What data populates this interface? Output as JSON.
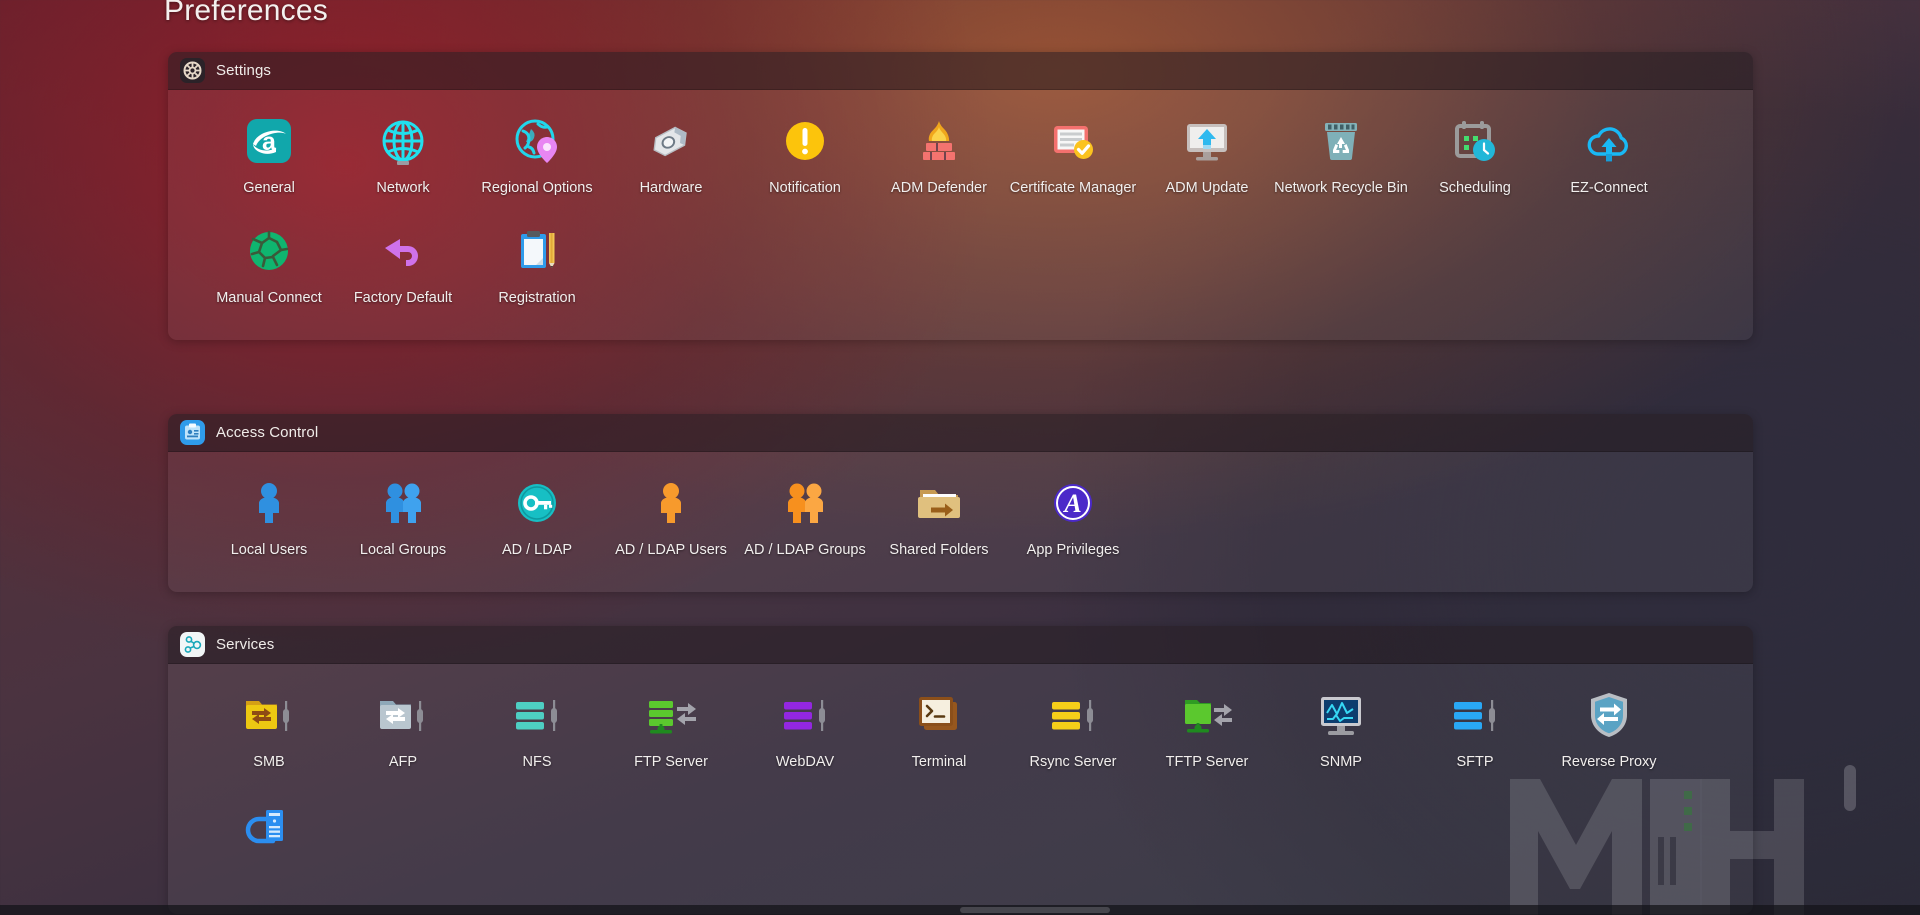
{
  "page": {
    "title": "Preferences",
    "accent_teal": "#21d3e0",
    "accent_blue": "#2e9bf0",
    "accent_orange": "#f79421",
    "accent_yellow": "#f5c518"
  },
  "sections": [
    {
      "id": "settings",
      "title": "Settings",
      "header_icon": "gear-icon",
      "items": [
        {
          "label": "General",
          "icon": "adm-logo-icon"
        },
        {
          "label": "Network",
          "icon": "globe-icon"
        },
        {
          "label": "Regional Options",
          "icon": "globe-pin-icon"
        },
        {
          "label": "Hardware",
          "icon": "nut-bolt-icon"
        },
        {
          "label": "Notification",
          "icon": "exclamation-circle-icon"
        },
        {
          "label": "ADM Defender",
          "icon": "firewall-icon"
        },
        {
          "label": "Certificate Manager",
          "icon": "certificate-check-icon"
        },
        {
          "label": "ADM Update",
          "icon": "monitor-upload-icon"
        },
        {
          "label": "Network Recycle Bin",
          "icon": "recycle-bin-icon"
        },
        {
          "label": "Scheduling",
          "icon": "calendar-clock-icon"
        },
        {
          "label": "EZ-Connect",
          "icon": "cloud-upload-icon"
        },
        {
          "label": "Manual Connect",
          "icon": "green-globe-icon"
        },
        {
          "label": "Factory Default",
          "icon": "undo-arrow-icon"
        },
        {
          "label": "Registration",
          "icon": "clipboard-pencil-icon"
        }
      ]
    },
    {
      "id": "access",
      "title": "Access Control",
      "header_icon": "id-badge-icon",
      "items": [
        {
          "label": "Local Users",
          "icon": "user-blue-icon"
        },
        {
          "label": "Local Groups",
          "icon": "users-blue-icon"
        },
        {
          "label": "AD / LDAP",
          "icon": "key-circle-icon"
        },
        {
          "label": "AD / LDAP Users",
          "icon": "user-orange-icon"
        },
        {
          "label": "AD / LDAP Groups",
          "icon": "users-orange-icon"
        },
        {
          "label": "Shared Folders",
          "icon": "folder-arrow-icon"
        },
        {
          "label": "App Privileges",
          "icon": "app-privileges-icon"
        }
      ]
    },
    {
      "id": "services",
      "title": "Services",
      "header_icon": "services-node-icon",
      "items": [
        {
          "label": "SMB",
          "icon": "folder-exchange-yellow-icon"
        },
        {
          "label": "AFP",
          "icon": "folder-exchange-grey-icon"
        },
        {
          "label": "NFS",
          "icon": "server-teal-icon"
        },
        {
          "label": "FTP Server",
          "icon": "server-green-exchange-icon"
        },
        {
          "label": "WebDAV",
          "icon": "server-purple-icon"
        },
        {
          "label": "Terminal",
          "icon": "terminal-icon"
        },
        {
          "label": "Rsync Server",
          "icon": "server-yellow-icon"
        },
        {
          "label": "TFTP Server",
          "icon": "folder-green-exchange-icon"
        },
        {
          "label": "SNMP",
          "icon": "monitor-chart-icon"
        },
        {
          "label": "SFTP",
          "icon": "server-blue-icon"
        },
        {
          "label": "Reverse Proxy",
          "icon": "shield-exchange-icon"
        },
        {
          "label": "",
          "icon": "cloud-server-icon"
        }
      ]
    }
  ],
  "watermark": {
    "text": "MH"
  }
}
